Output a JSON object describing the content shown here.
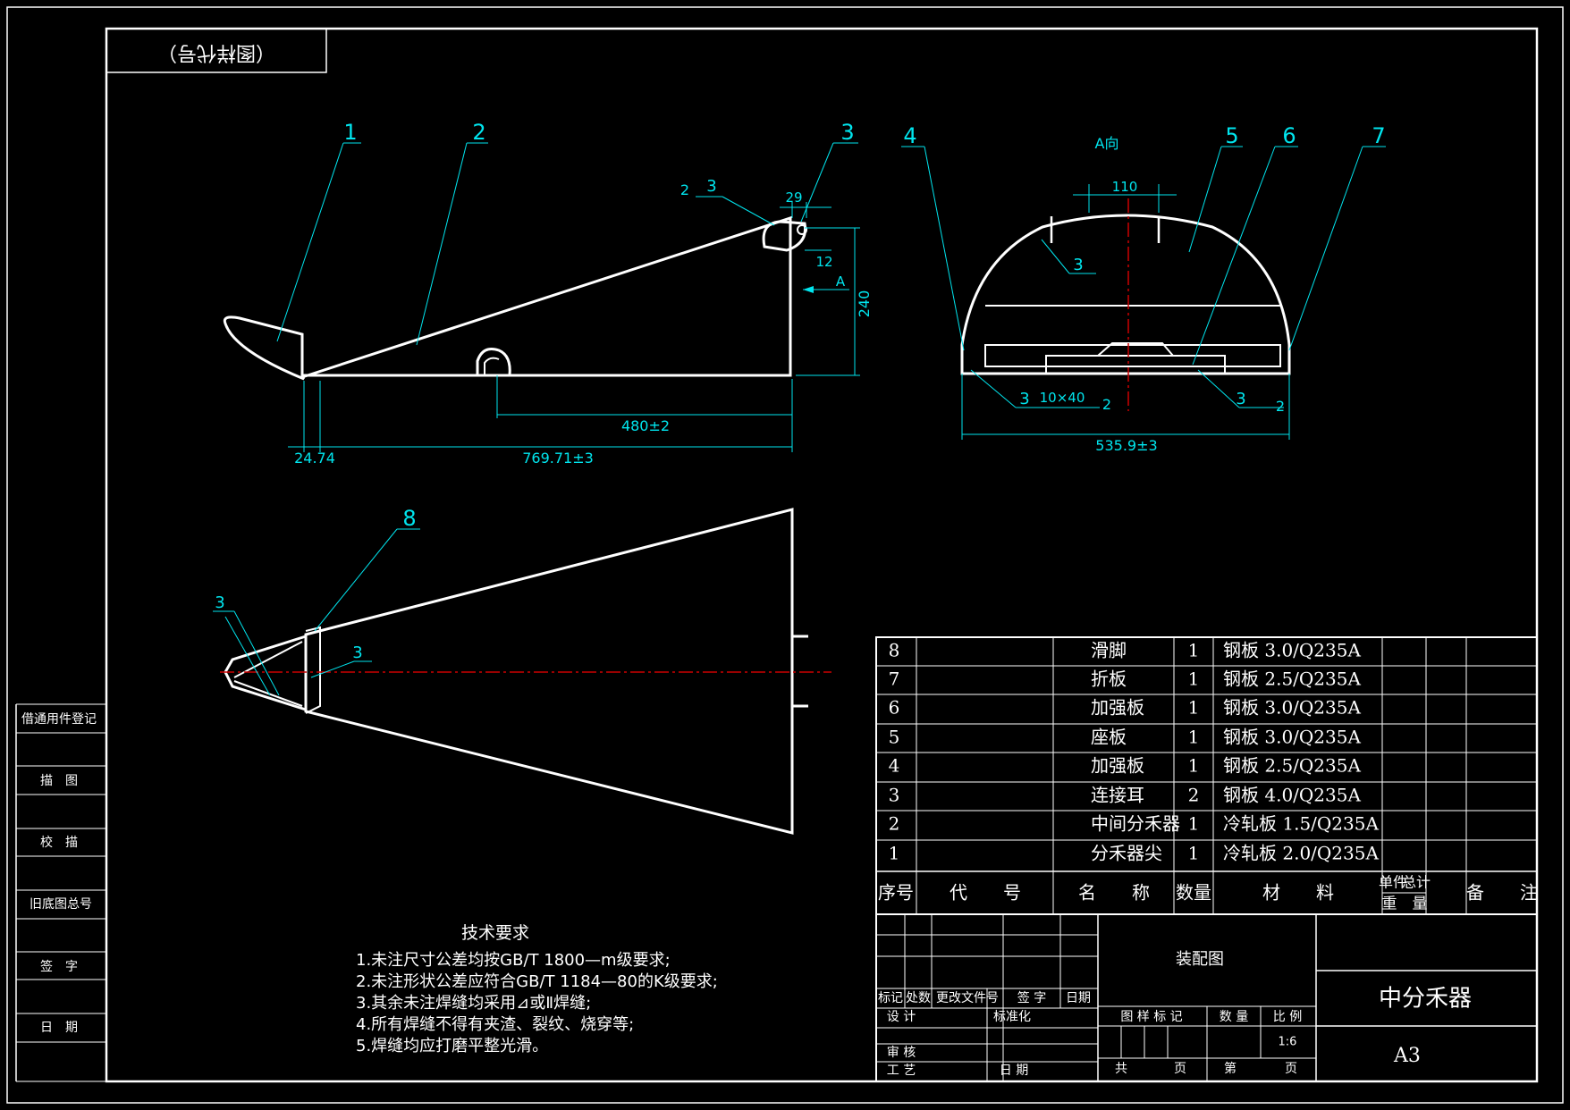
{
  "stamp_label": "（图样代号）",
  "left_strip": [
    "借通用件登记",
    "描　图",
    "校　描",
    "旧底图总号",
    "签　字",
    "日　期"
  ],
  "balloons": [
    "1",
    "2",
    "3",
    "4",
    "5",
    "6",
    "7",
    "8"
  ],
  "view_label": "A向",
  "weld_symbols": [
    "3",
    "3",
    "3",
    "3",
    "3",
    "3",
    "3"
  ],
  "weld_extra": {
    "two_a": "2",
    "two_b": "2",
    "two_c": "2",
    "stitch": "10×40"
  },
  "dimensions": {
    "d29": "29",
    "d12": "12",
    "dA": "A",
    "d240": "240",
    "d480": "480±2",
    "d2474": "24.74",
    "d769": "769.71±3",
    "d110": "110",
    "d535": "535.9±3"
  },
  "bom": {
    "rows": [
      {
        "no": "8",
        "code": "",
        "name": "滑脚",
        "qty": "1",
        "material": "钢板 3.0/Q235A"
      },
      {
        "no": "7",
        "code": "",
        "name": "折板",
        "qty": "1",
        "material": "钢板 2.5/Q235A"
      },
      {
        "no": "6",
        "code": "",
        "name": "加强板",
        "qty": "1",
        "material": "钢板 3.0/Q235A"
      },
      {
        "no": "5",
        "code": "",
        "name": "座板",
        "qty": "1",
        "material": "钢板 3.0/Q235A"
      },
      {
        "no": "4",
        "code": "",
        "name": "加强板",
        "qty": "1",
        "material": "钢板 2.5/Q235A"
      },
      {
        "no": "3",
        "code": "",
        "name": "连接耳",
        "qty": "2",
        "material": "钢板 4.0/Q235A"
      },
      {
        "no": "2",
        "code": "",
        "name": "中间分禾器",
        "qty": "1",
        "material": "冷轧板 1.5/Q235A"
      },
      {
        "no": "1",
        "code": "",
        "name": "分禾器尖",
        "qty": "1",
        "material": "冷轧板 2.0/Q235A"
      }
    ],
    "headers": {
      "no": "序号",
      "code": "代　　号",
      "name": "名　　称",
      "qty": "数量",
      "material": "材　　料",
      "unit_a": "单件",
      "unit_b": "总计",
      "weight": "重　量",
      "remark": "备　　注"
    }
  },
  "tech": {
    "title": "技术要求",
    "lines": [
      "1.未注尺寸公差均按GB/T 1800—m级要求;",
      "2.未注形状公差应符合GB/T 1184—80的K级要求;",
      "3.其余未注焊缝均采用⊿或Ⅱ焊缝;",
      "4.所有焊缝不得有夹渣、裂纹、烧穿等;",
      "5.焊缝均应打磨平整光滑。"
    ]
  },
  "title_block": {
    "rev_headers": [
      "标记",
      "处数",
      "更改文件号",
      "签 字",
      "日期"
    ],
    "design": "设 计",
    "std": "标准化",
    "review": "审 核",
    "craft": "工 艺",
    "date": "日 期",
    "drawing_type": "装配图",
    "mark_label": "图 样 标 记",
    "qty_label": "数 量",
    "scale_label": "比 例",
    "scale": "1:6",
    "total": "共",
    "page": "页",
    "nth": "第",
    "page2": "页",
    "name": "中分禾器",
    "sheet": "A3"
  }
}
